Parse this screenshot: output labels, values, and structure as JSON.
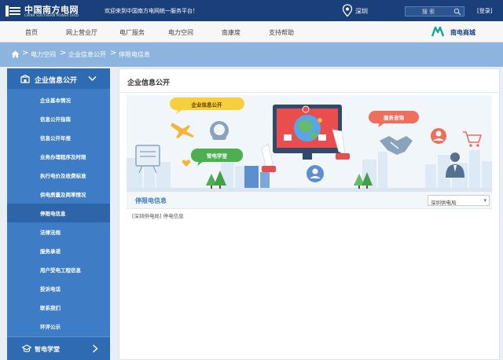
{
  "header": {
    "logo_cn": "中国南方电网",
    "logo_en": "CHINA SOUTHERN POWER GRID",
    "welcome": "欢迎来到中国南方电网统一服务平台！",
    "location": "深圳",
    "search_placeholder": "搜 索",
    "login": "[登录]"
  },
  "nav": {
    "items": [
      {
        "label": "首页"
      },
      {
        "label": "网上营业厅"
      },
      {
        "label": "电厂服务"
      },
      {
        "label": "电力空间"
      },
      {
        "label": "南康度"
      },
      {
        "label": "支持帮助"
      }
    ],
    "mall": "南电商城"
  },
  "breadcrumb": {
    "items": [
      {
        "label": "电力空间"
      },
      {
        "label": "企业信息公开"
      },
      {
        "label": "停限电信息"
      }
    ],
    "sep": ">"
  },
  "sidebar": {
    "section_title": "企业信息公开",
    "items": [
      {
        "label": "企业基本情况"
      },
      {
        "label": "信息公开指南"
      },
      {
        "label": "信息公开年报"
      },
      {
        "label": "业务办理程序及时限"
      },
      {
        "label": "执行电价及收费标准"
      },
      {
        "label": "供电质量及两率情况"
      },
      {
        "label": "停限电信息"
      },
      {
        "label": "法律法规"
      },
      {
        "label": "服务承诺"
      },
      {
        "label": "用户受电工程信息"
      },
      {
        "label": "投诉电话"
      },
      {
        "label": "联系我们"
      },
      {
        "label": "环评公示"
      }
    ],
    "active_index": 6,
    "footer_label": "智电学堂"
  },
  "content": {
    "title": "企业信息公开",
    "banner": {
      "bubble_left": "企业信息公开",
      "bubble_right": "服务咨询",
      "bubble_green": "智电学堂"
    },
    "list": {
      "title": "停限电信息",
      "select_value": "深圳供电局",
      "rows": [
        {
          "text": "[深圳供电局] 停电信息"
        }
      ]
    }
  },
  "colors": {
    "top_bar": "#1a3f7a",
    "sidebar": "#3e7dc6",
    "sidebar_active": "#2e65a8",
    "breadcrumb": "#8cb4de",
    "bubble_yellow": "#f7cf3c",
    "bubble_red": "#ef6f5d",
    "bubble_green": "#4caf50"
  }
}
